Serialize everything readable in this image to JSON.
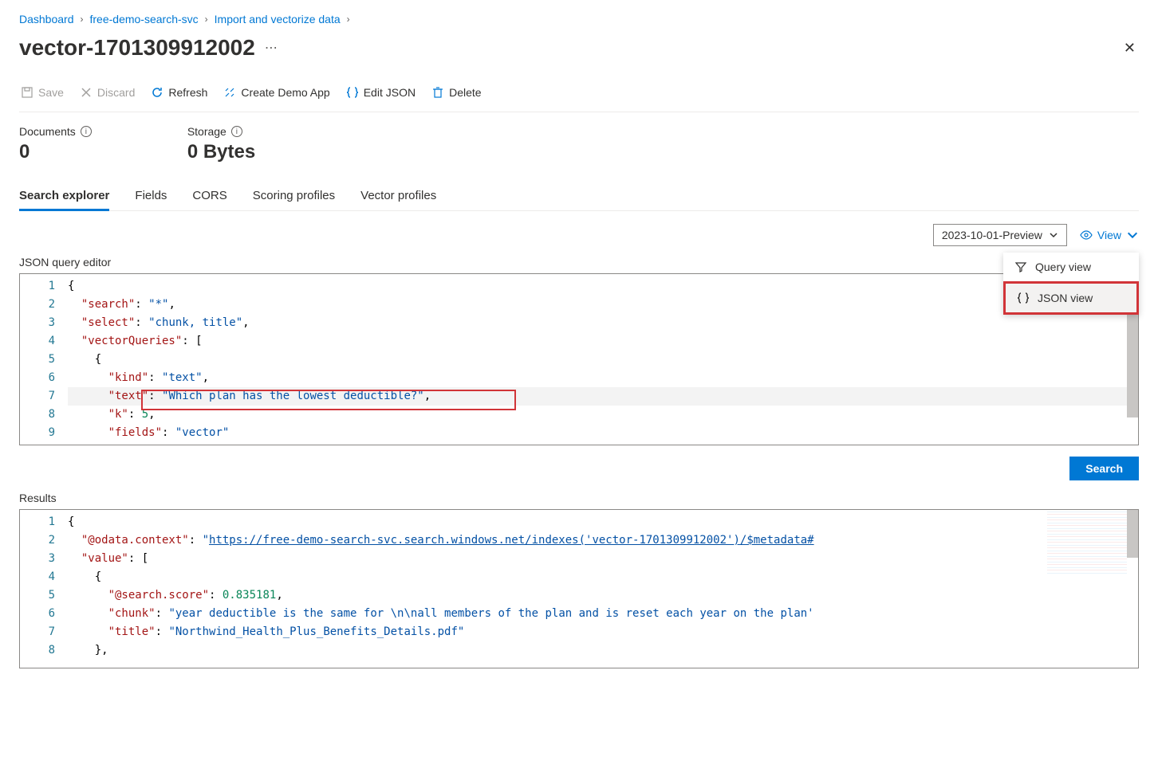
{
  "breadcrumb": {
    "items": [
      "Dashboard",
      "free-demo-search-svc",
      "Import and vectorize data"
    ]
  },
  "page": {
    "title": "vector-1701309912002"
  },
  "toolbar": {
    "save": "Save",
    "discard": "Discard",
    "refresh": "Refresh",
    "createDemo": "Create Demo App",
    "editJson": "Edit JSON",
    "delete": "Delete"
  },
  "stats": {
    "documentsLabel": "Documents",
    "documentsValue": "0",
    "storageLabel": "Storage",
    "storageValue": "0 Bytes"
  },
  "tabs": [
    "Search explorer",
    "Fields",
    "CORS",
    "Scoring profiles",
    "Vector profiles"
  ],
  "activeTab": "Search explorer",
  "apiVersion": "2023-10-01-Preview",
  "viewLabel": "View",
  "viewMenu": {
    "query": "Query view",
    "json": "JSON view"
  },
  "editorLabel": "JSON query editor",
  "queryJson": {
    "lineNumbers": [
      "1",
      "2",
      "3",
      "4",
      "5",
      "6",
      "7",
      "8",
      "9"
    ],
    "content": {
      "search": "*",
      "select": "chunk, title",
      "vectorQueries": [
        {
          "kind": "text",
          "text": "Which plan has the lowest deductible?",
          "k": 5,
          "fields": "vector"
        }
      ]
    }
  },
  "searchButton": "Search",
  "resultsLabel": "Results",
  "resultsJson": {
    "lineNumbers": [
      "1",
      "2",
      "3",
      "4",
      "5",
      "6",
      "7",
      "8"
    ],
    "odataContext": "https://free-demo-search-svc.search.windows.net/indexes('vector-1701309912002')/$metadata#",
    "value": [
      {
        "@search.score": 0.835181,
        "chunk": "year deductible is the same for \\n\\nall members of the plan and is reset each year on the plan'",
        "title": "Northwind_Health_Plus_Benefits_Details.pdf"
      }
    ]
  }
}
